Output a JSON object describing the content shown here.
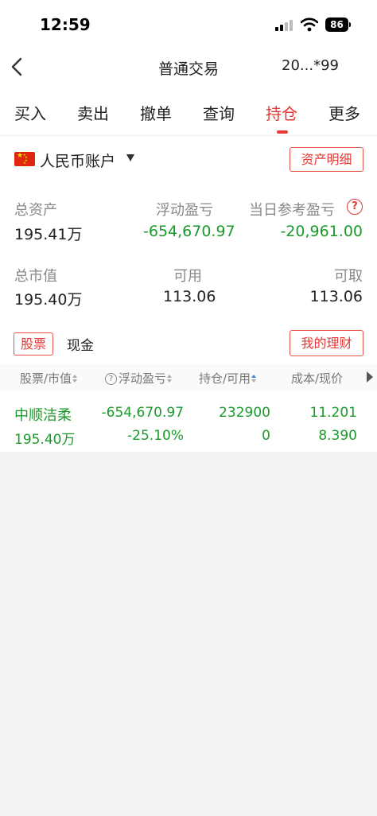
{
  "status_bar": {
    "time": "12:59",
    "battery": "86"
  },
  "nav": {
    "title": "普通交易",
    "account_code": "20...*99"
  },
  "tabs": [
    {
      "label": "买入",
      "active": false
    },
    {
      "label": "卖出",
      "active": false
    },
    {
      "label": "撤单",
      "active": false
    },
    {
      "label": "查询",
      "active": false
    },
    {
      "label": "持仓",
      "active": true
    },
    {
      "label": "更多",
      "active": false
    }
  ],
  "account": {
    "name": "人民币账户",
    "detail_button": "资产明细"
  },
  "summary": {
    "total_assets_label": "总资产",
    "total_assets": "195.41万",
    "floating_pl_label": "浮动盈亏",
    "floating_pl": "-654,670.97",
    "daily_pl_label": "当日参考盈亏",
    "daily_pl": "-20,961.00",
    "market_value_label": "总市值",
    "market_value": "195.40万",
    "available_label": "可用",
    "available": "113.06",
    "withdrawable_label": "可取",
    "withdrawable": "113.06"
  },
  "subtabs": {
    "stock": "股票",
    "cash": "现金",
    "wealth_button": "我的理财"
  },
  "table": {
    "col_stock": "股票/市值",
    "col_pl": "浮动盈亏",
    "col_position": "持仓/可用",
    "col_cost": "成本/现价",
    "rows": [
      {
        "name": "中顺洁柔",
        "market_value": "195.40万",
        "pl": "-654,670.97",
        "pl_pct": "-25.10%",
        "position": "232900",
        "available": "0",
        "cost": "11.201",
        "price": "8.390"
      }
    ]
  },
  "colors": {
    "accent": "#e53935",
    "loss_green": "#1a9a2a",
    "sort_active": "#3b7ddd"
  }
}
